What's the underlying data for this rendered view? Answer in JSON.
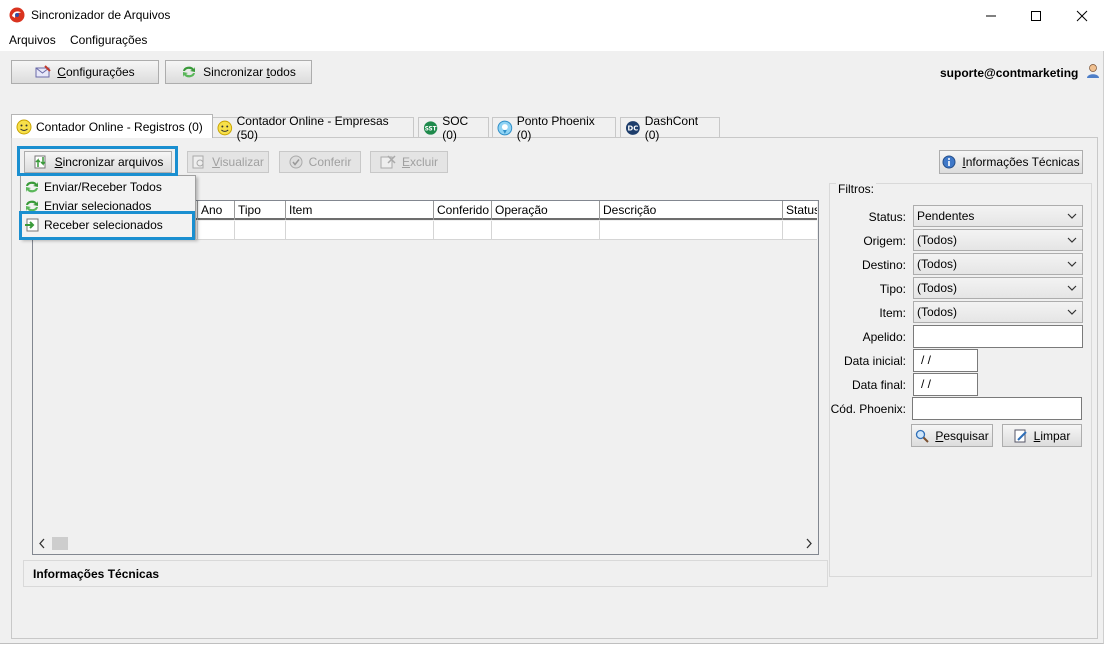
{
  "window": {
    "title": "Sincronizador de Arquivos"
  },
  "menu": {
    "items": [
      "Arquivos",
      "Configurações"
    ]
  },
  "toolbar": {
    "config_label_u": "C",
    "config_label_rest": "onfigurações",
    "sync_all_pre": "Sincronizar ",
    "sync_all_u": "t",
    "sync_all_rest": "odos"
  },
  "user": {
    "email": "suporte@contmarketing"
  },
  "tabs": [
    {
      "label": "Contador Online - Registros (0)"
    },
    {
      "label": "Contador Online - Empresas (50)"
    },
    {
      "label": "SOC (0)"
    },
    {
      "label": "Ponto Phoenix (0)"
    },
    {
      "label": "DashCont (0)"
    }
  ],
  "actions": {
    "sync_files_u": "S",
    "sync_files_rest": "incronizar arquivos",
    "view_u": "V",
    "view_rest": "isualizar",
    "check": "Conferir",
    "delete_u": "E",
    "delete_rest": "xcluir",
    "tech_info_u": "I",
    "tech_info_rest": "nformações Técnicas"
  },
  "sync_menu": {
    "items": [
      "Enviar/Receber Todos",
      "Enviar selecionados",
      "Receber selecionados"
    ]
  },
  "grid": {
    "columns": [
      "Ano",
      "Tipo",
      "Item",
      "Conferido",
      "Operação",
      "Descrição",
      "Status"
    ]
  },
  "info_panel": {
    "title": "Informações Técnicas"
  },
  "filters": {
    "title": "Filtros:",
    "status_label": "Status:",
    "status_value": "Pendentes",
    "origem_label": "Origem:",
    "origem_value": "(Todos)",
    "destino_label": "Destino:",
    "destino_value": "(Todos)",
    "tipo_label": "Tipo:",
    "tipo_value": "(Todos)",
    "item_label": "Item:",
    "item_value": "(Todos)",
    "apelido_label": "Apelido:",
    "apelido_value": "",
    "data_inicial_label": "Data inicial:",
    "data_inicial_value": " /  /",
    "data_final_label": "Data final:",
    "data_final_value": " /  /",
    "cod_phoenix_label": "Cód. Phoenix:",
    "cod_phoenix_value": "",
    "search_u": "P",
    "search_rest": "esquisar",
    "clear_u": "L",
    "clear_rest": "impar"
  },
  "colors": {
    "highlight": "#1a8fd0",
    "sync_icon": "#3a9a3a"
  }
}
